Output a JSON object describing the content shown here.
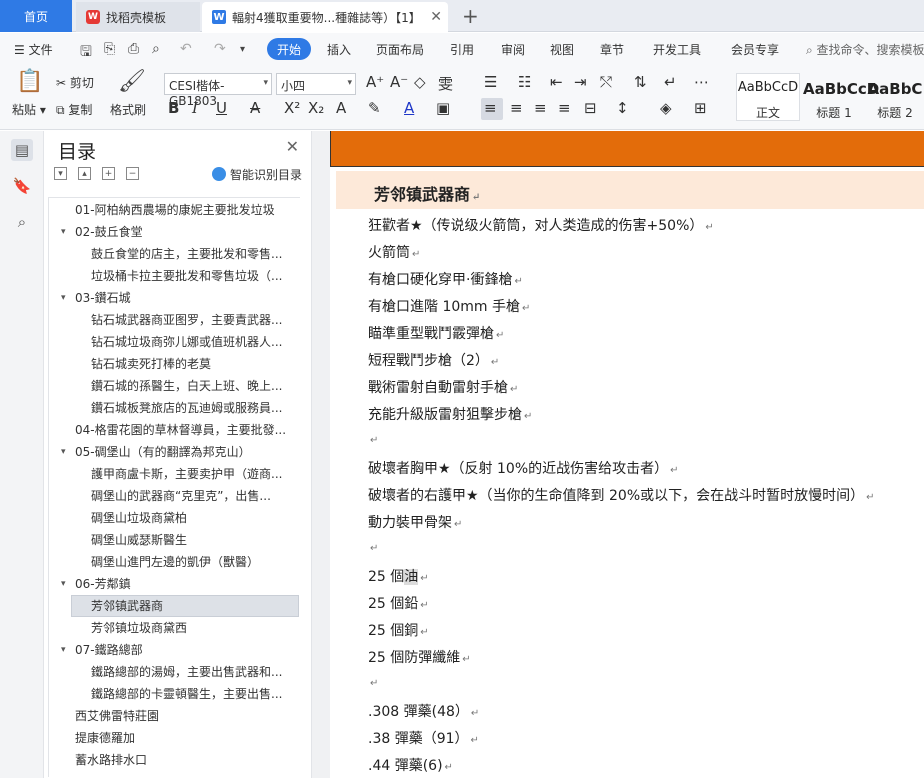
{
  "tabs": {
    "home": "首页",
    "template": "找稻壳模板",
    "document": "輻射4獲取重要物...種雜誌等）【1】"
  },
  "menu": {
    "file": "文件",
    "start": "开始",
    "insert": "插入",
    "layout": "页面布局",
    "reference": "引用",
    "review": "审阅",
    "view": "视图",
    "chapter": "章节",
    "devtools": "开发工具",
    "member": "会员专享",
    "search": "查找命令、搜索模板"
  },
  "ribbon": {
    "paste": "粘贴",
    "cut": "剪切",
    "copy": "复制",
    "format_painter": "格式刷",
    "font_name": "CESI楷体-GB1803",
    "font_size": "小四",
    "styles": [
      {
        "sample": "AaBbCcD",
        "name": "正文"
      },
      {
        "sample": "AaBbCcD",
        "name": "标题 1"
      },
      {
        "sample": "AaBbC",
        "name": "标题 2"
      }
    ]
  },
  "toc": {
    "title": "目录",
    "smart": "智能识别目录",
    "items": [
      {
        "text": "01-阿柏納西農場的康妮主要批发垃圾",
        "level": 1,
        "caret": ""
      },
      {
        "text": "02-鼓丘食堂",
        "level": 1,
        "caret": "v"
      },
      {
        "text": "鼓丘食堂的店主，主要批发和零售...",
        "level": 2,
        "caret": ""
      },
      {
        "text": "垃圾桶卡拉主要批发和零售垃圾（...",
        "level": 2,
        "caret": ""
      },
      {
        "text": "03-鑽石城",
        "level": 1,
        "caret": "v"
      },
      {
        "text": "钻石城武器商亚图罗，主要責武器...",
        "level": 2,
        "caret": ""
      },
      {
        "text": "钻石城垃圾商弥儿娜或值班机器人...",
        "level": 2,
        "caret": ""
      },
      {
        "text": "钻石城卖死打棒的老莫",
        "level": 2,
        "caret": ""
      },
      {
        "text": "鑽石城的孫醫生，白天上班、晚上...",
        "level": 2,
        "caret": ""
      },
      {
        "text": "鑽石城板凳旅店的瓦迪姆或服務員...",
        "level": 2,
        "caret": ""
      },
      {
        "text": "04-格雷花園的草林督導員，主要批發...",
        "level": 1,
        "caret": ""
      },
      {
        "text": "05-碉堡山（有的翻譯為邦克山）",
        "level": 1,
        "caret": "v"
      },
      {
        "text": "護甲商盧卡斯，主要卖护甲（遊商...",
        "level": 2,
        "caret": ""
      },
      {
        "text": "碉堡山的武器商“克里克”，出售...",
        "level": 2,
        "caret": ""
      },
      {
        "text": "碉堡山垃圾商黛柏",
        "level": 2,
        "caret": ""
      },
      {
        "text": "碉堡山威瑟斯醫生",
        "level": 2,
        "caret": ""
      },
      {
        "text": "碉堡山進門左邊的凱伊（獸醫）",
        "level": 2,
        "caret": ""
      },
      {
        "text": "06-芳鄰鎮",
        "level": 1,
        "caret": "v"
      },
      {
        "text": "芳邻镇武器商",
        "level": 2,
        "caret": "",
        "selected": true
      },
      {
        "text": "芳邻镇垃圾商黛西",
        "level": 2,
        "caret": ""
      },
      {
        "text": "07-鐵路總部",
        "level": 1,
        "caret": "v"
      },
      {
        "text": "鐵路總部的湯姆，主要出售武器和...",
        "level": 2,
        "caret": ""
      },
      {
        "text": "鐵路總部的卡靈頓醫生，主要出售...",
        "level": 2,
        "caret": ""
      },
      {
        "text": "西艾佛雷特莊園",
        "level": 1,
        "caret": ""
      },
      {
        "text": "提康德羅加",
        "level": 1,
        "caret": ""
      },
      {
        "text": "蓄水路排水口",
        "level": 1,
        "caret": ""
      }
    ]
  },
  "doc": {
    "heading": "芳邻镇武器商",
    "lines": [
      "狂歡者★（传说级火箭筒，对人类造成的伤害+50%）",
      "火箭筒",
      "有槍口硬化穿甲·衝鋒槍",
      "有槍口進階 10mm 手槍",
      "瞄準重型戰鬥霰彈槍",
      "短程戰鬥步槍（2）",
      "戰術雷射自動雷射手槍",
      "充能升級版雷射狙擊步槍",
      "",
      "破壞者胸甲★（反射 10%的近战伤害给攻击者）",
      "破壞者的右護甲★（当你的生命值降到 20%或以下，会在战斗时暂时放慢时间）",
      "動力裝甲骨架",
      "",
      "25 個油",
      "25 個鉛",
      "25 個銅",
      "25 個防彈纖維",
      "",
      ".308 彈藥(48）",
      ".38 彈藥（91）",
      ".44 彈藥(6)"
    ]
  }
}
